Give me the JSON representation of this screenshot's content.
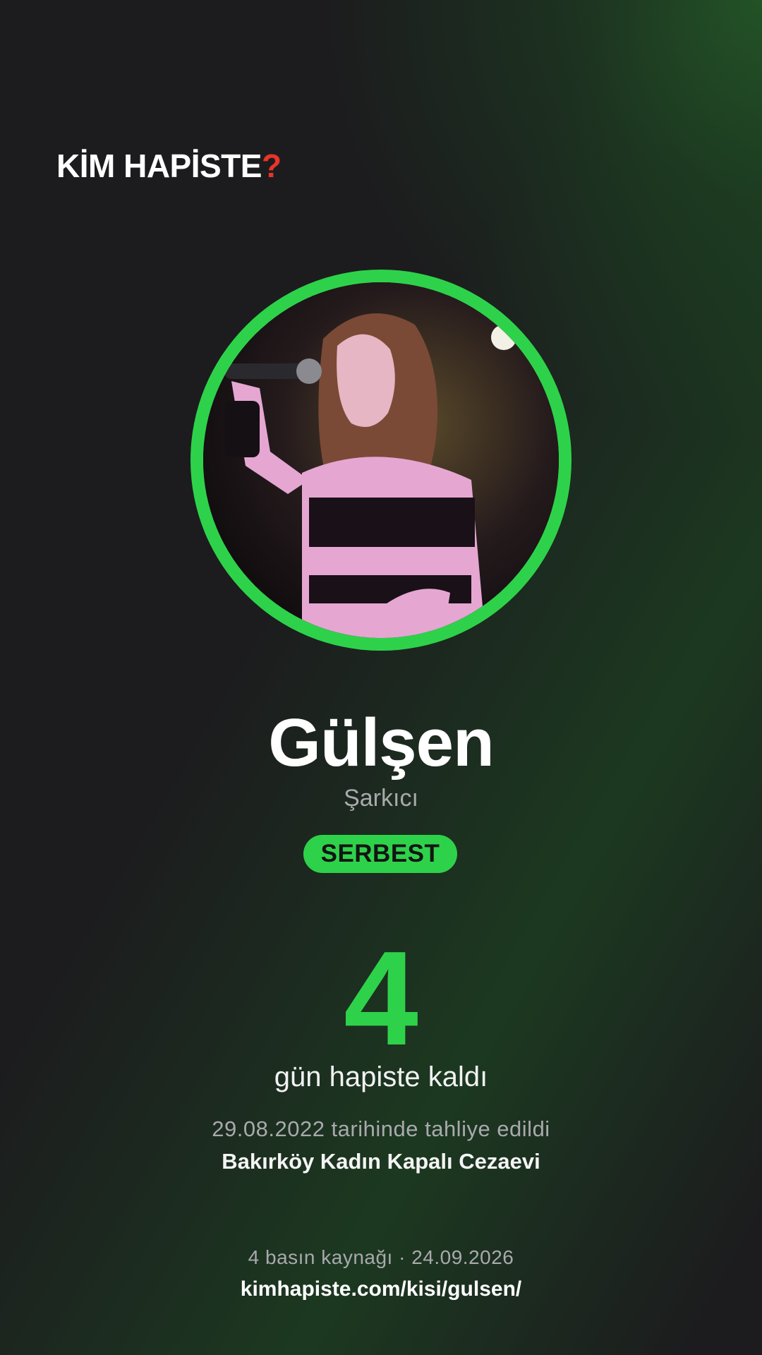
{
  "brand": {
    "name": "KİM HAPİSTE",
    "mark": "?"
  },
  "profile": {
    "photo_icon": "singer-photo",
    "name": "Gülşen",
    "profession": "Şarkıcı",
    "status": "SERBEST"
  },
  "stats": {
    "days": "4",
    "days_label": "gün hapiste kaldı",
    "release_text": "29.08.2022 tarihinde tahliye edildi",
    "prison": "Bakırköy Kadın Kapalı Cezaevi"
  },
  "footer": {
    "sources": "4 basın kaynağı · 24.09.2026",
    "url": "kimhapiste.com/kisi/gulsen/"
  },
  "colors": {
    "accent": "#2ed24a",
    "logo_question": "#e8342a",
    "background": "#1c1c1e"
  }
}
